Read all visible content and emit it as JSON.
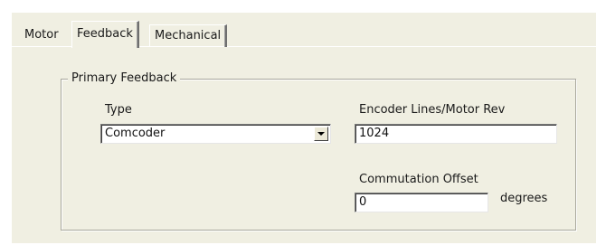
{
  "tabs": [
    {
      "label": "Motor",
      "active": false
    },
    {
      "label": "Feedback",
      "active": true
    },
    {
      "label": "Mechanical",
      "active": false
    }
  ],
  "primary_feedback": {
    "group_title": "Primary Feedback",
    "type_label": "Type",
    "type_value": "Comcoder",
    "encoder_label": "Encoder Lines/Motor Rev",
    "encoder_value": "1024",
    "commutation_label": "Commutation Offset",
    "commutation_value": "0",
    "commutation_unit": "degrees"
  },
  "icons": {
    "dropdown": "chevron-down-icon"
  },
  "colors": {
    "dialog_background": "#f0efe2",
    "field_background": "#ffffff"
  }
}
